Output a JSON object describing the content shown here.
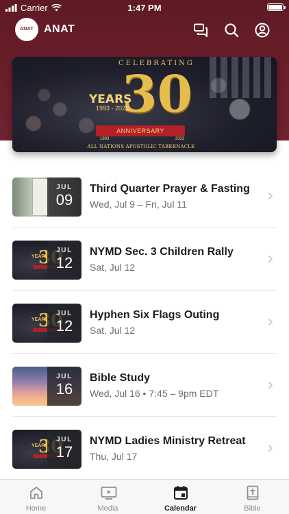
{
  "status_bar": {
    "carrier": "Carrier",
    "time": "1:47 PM"
  },
  "header": {
    "app_title": "ANAT",
    "logo_text": "ANAT"
  },
  "banner": {
    "celebrating": "CELEBRATING",
    "years_word": "YEARS",
    "year_range": "1993 - 2023",
    "big_number": "30",
    "ribbon": "ANNIVERSARY",
    "year_left": "1993",
    "year_right": "2023",
    "church_name": "ALL NATIONS APOSTOLIC TABERNACLE"
  },
  "events": [
    {
      "title": "Third Quarter Prayer & Fasting",
      "subtitle": "Wed, Jul 9 – Fri, Jul 11",
      "month": "JUL",
      "day": "09",
      "thumb": "prayer"
    },
    {
      "title": "NYMD Sec. 3 Children Rally",
      "subtitle": "Sat, Jul 12",
      "month": "JUL",
      "day": "12",
      "thumb": "anniversary"
    },
    {
      "title": "Hyphen Six Flags Outing",
      "subtitle": "Sat, Jul 12",
      "month": "JUL",
      "day": "12",
      "thumb": "anniversary"
    },
    {
      "title": "Bible Study",
      "subtitle": "Wed, Jul 16 • 7:45 – 9pm EDT",
      "month": "JUL",
      "day": "16",
      "thumb": "sky"
    },
    {
      "title": "NYMD Ladies Ministry Retreat",
      "subtitle": "Thu, Jul 17",
      "month": "JUL",
      "day": "17",
      "thumb": "anniversary"
    }
  ],
  "tabs": [
    {
      "label": "Home",
      "icon": "home-icon",
      "active": false
    },
    {
      "label": "Media",
      "icon": "play-icon",
      "active": false
    },
    {
      "label": "Calendar",
      "icon": "calendar-icon",
      "active": true
    },
    {
      "label": "Bible",
      "icon": "bible-icon",
      "active": false
    }
  ],
  "colors": {
    "brand": "#6b1f2b",
    "gold": "#e5bd4e"
  }
}
